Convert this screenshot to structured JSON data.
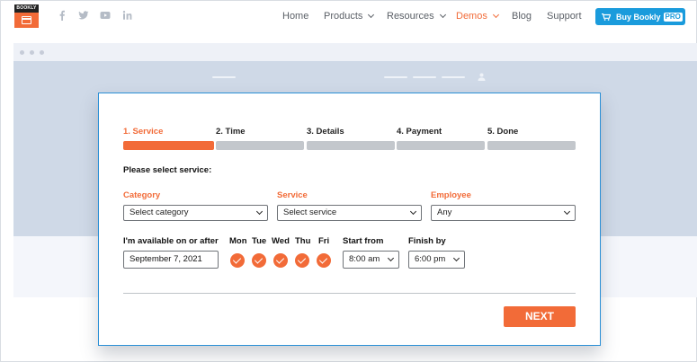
{
  "brand": {
    "logo_text": "BOOKLY",
    "accent": "#f26b38",
    "blue": "#1a9bdc"
  },
  "social": [
    "facebook-icon",
    "twitter-icon",
    "youtube-icon",
    "linkedin-icon"
  ],
  "nav": {
    "home": "Home",
    "products": "Products",
    "resources": "Resources",
    "demos": "Demos",
    "blog": "Blog",
    "support": "Support",
    "buy_label": "Buy Bookly",
    "buy_badge": "PRO"
  },
  "wizard": {
    "steps": [
      {
        "label": "1. Service"
      },
      {
        "label": "2. Time"
      },
      {
        "label": "3. Details"
      },
      {
        "label": "4. Payment"
      },
      {
        "label": "5. Done"
      }
    ],
    "active_step": 1,
    "prompt": "Please select service:",
    "category": {
      "label": "Category",
      "value": "Select category"
    },
    "service": {
      "label": "Service",
      "value": "Select service"
    },
    "employee": {
      "label": "Employee",
      "value": "Any"
    },
    "available_label": "I'm available on or after",
    "date_value": "September 7, 2021",
    "days": [
      "Mon",
      "Tue",
      "Wed",
      "Thu",
      "Fri"
    ],
    "start": {
      "label": "Start from",
      "value": "8:00 am"
    },
    "finish": {
      "label": "Finish by",
      "value": "6:00 pm"
    },
    "next_label": "NEXT"
  }
}
